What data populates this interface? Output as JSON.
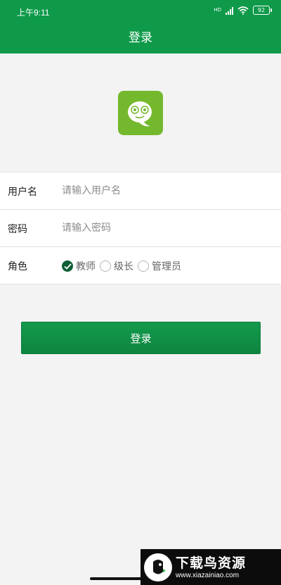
{
  "status_bar": {
    "time": "上午9:11",
    "network": "HD",
    "battery": "92"
  },
  "header": {
    "title": "登录"
  },
  "form": {
    "username": {
      "label": "用户名",
      "placeholder": "请输入用户名",
      "value": ""
    },
    "password": {
      "label": "密码",
      "placeholder": "请输入密码",
      "value": ""
    },
    "role": {
      "label": "角色",
      "options": [
        {
          "label": "教师",
          "checked": true
        },
        {
          "label": "级长",
          "checked": false
        },
        {
          "label": "管理员",
          "checked": false
        }
      ]
    }
  },
  "actions": {
    "login_label": "登录"
  },
  "watermark": {
    "title": "下载鸟资源",
    "url": "www.xiazainiao.com"
  },
  "colors": {
    "primary": "#0f9a4a",
    "logo_bg": "#74b82d",
    "radio_checked": "#0e5f35",
    "background": "#f3f3f3"
  },
  "icons": [
    "signal-icon",
    "wifi-icon",
    "battery-icon",
    "app-logo-icon",
    "check-icon"
  ]
}
